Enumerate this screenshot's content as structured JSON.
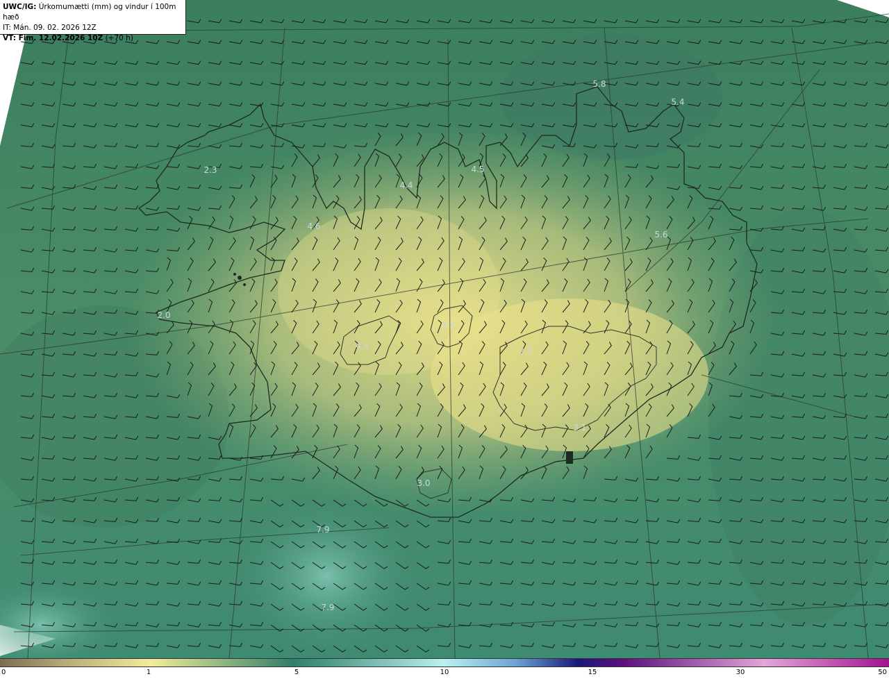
{
  "header": {
    "model": "UWC/IG:",
    "title": "Úrkomumætti (mm) og vindur í 100m hæð",
    "it_line": "IT: Mán. 09. 02. 2026 12Z",
    "vt_label": "VT: Fim. 12.02.2026 10Z",
    "vt_offset": "(+70 h)"
  },
  "map_values": [
    "5.8",
    "5.4",
    "2.3",
    "4.4",
    "4.5",
    "4.6",
    "2.0",
    "4.4",
    "5.6",
    "7.9",
    "7.9",
    "3.3",
    "2.2",
    "3.1",
    "3.0"
  ],
  "colorbar": {
    "ticks": [
      "0",
      "1",
      "5",
      "10",
      "15",
      "30",
      "50"
    ],
    "stops": [
      "#7b6d52",
      "#b6a778",
      "#f3ec9a",
      "#2f7f68",
      "#b9f1ef",
      "#6aa4d4",
      "#1a1878",
      "#5c0f7b",
      "#e2a6d8",
      "#a3128f"
    ]
  }
}
